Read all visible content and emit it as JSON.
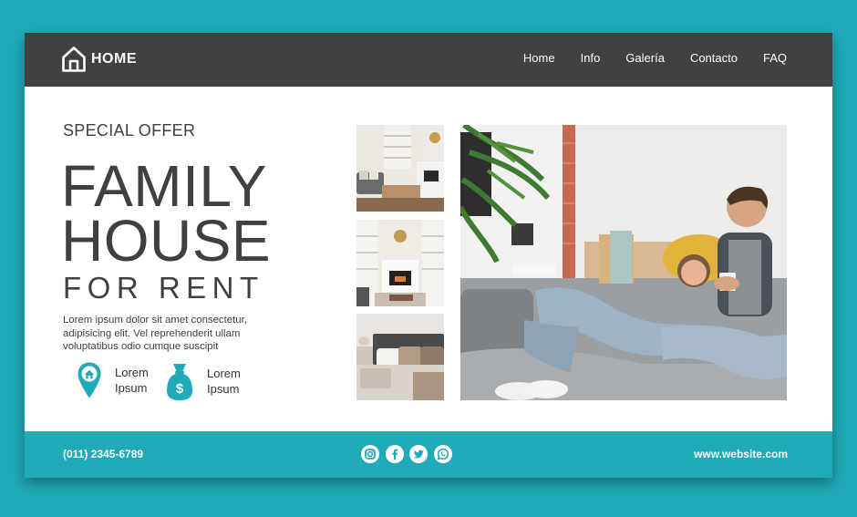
{
  "header": {
    "logo_icon": "home-outline-icon",
    "logo_text": "HOME",
    "nav": [
      {
        "label": "Home"
      },
      {
        "label": "Info"
      },
      {
        "label": "Galería"
      },
      {
        "label": "Contacto"
      },
      {
        "label": "FAQ"
      }
    ]
  },
  "hero": {
    "kicker": "SPECIAL OFFER",
    "title_line1": "FAMILY",
    "title_line2": "HOUSE",
    "subtitle": "FOR RENT",
    "description": "Lorem ipsum dolor sit amet consectetur, adipisicing elit. Vel reprehenderit ullam voluptatibus odio cumque suscipit",
    "features": [
      {
        "icon": "location-pin-icon",
        "line1": "Lorem",
        "line2": "Ipsum"
      },
      {
        "icon": "money-bag-icon",
        "line1": "Lorem",
        "line2": "Ipsum"
      }
    ]
  },
  "gallery": {
    "photos": [
      {
        "subject": "living-room-photo"
      },
      {
        "subject": "fireplace-photo"
      },
      {
        "subject": "bedroom-photo"
      },
      {
        "subject": "couple-on-sofa-photo"
      }
    ]
  },
  "footer": {
    "phone": "(011) 2345-6789",
    "social": [
      "instagram-icon",
      "facebook-icon",
      "twitter-icon",
      "whatsapp-icon"
    ],
    "website": "www.website.com"
  },
  "colors": {
    "accent": "#20aab8",
    "dark": "#414141",
    "text": "#404040"
  }
}
